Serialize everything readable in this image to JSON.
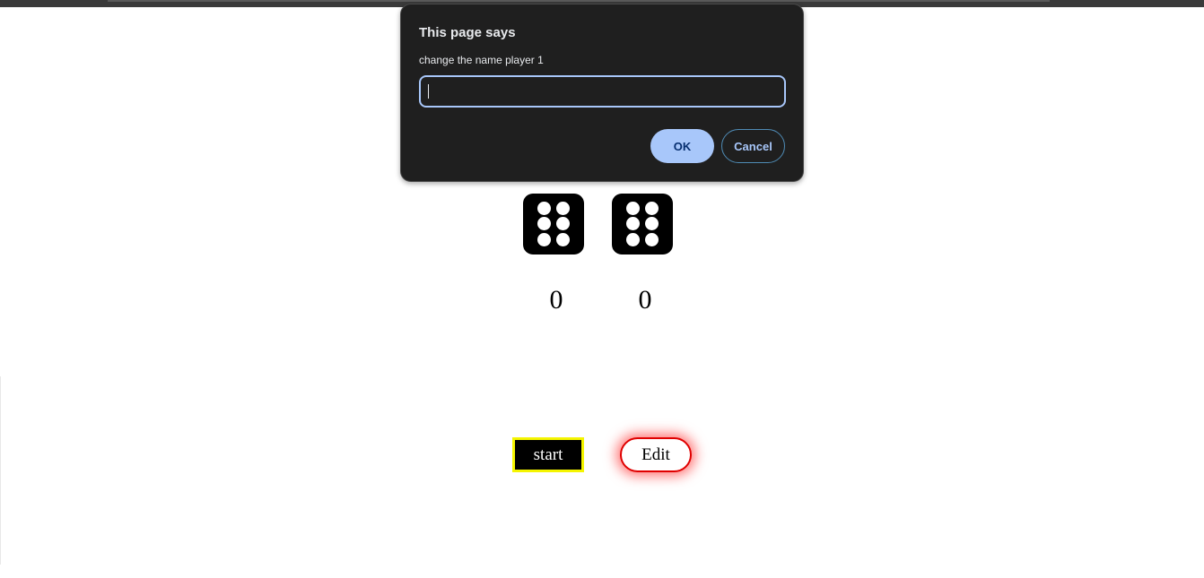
{
  "dialog": {
    "title": "This page says",
    "message": "change the name player 1",
    "input_value": "",
    "ok_label": "OK",
    "cancel_label": "Cancel"
  },
  "game": {
    "dice": [
      {
        "face": 6
      },
      {
        "face": 6
      }
    ],
    "scores": [
      "0",
      "0"
    ],
    "start_label": "start",
    "edit_label": "Edit"
  },
  "colors": {
    "dialog_bg": "#1f1f1f",
    "accent": "#a8c7fa",
    "start_border": "#f5f500",
    "edit_border": "#e00000"
  }
}
